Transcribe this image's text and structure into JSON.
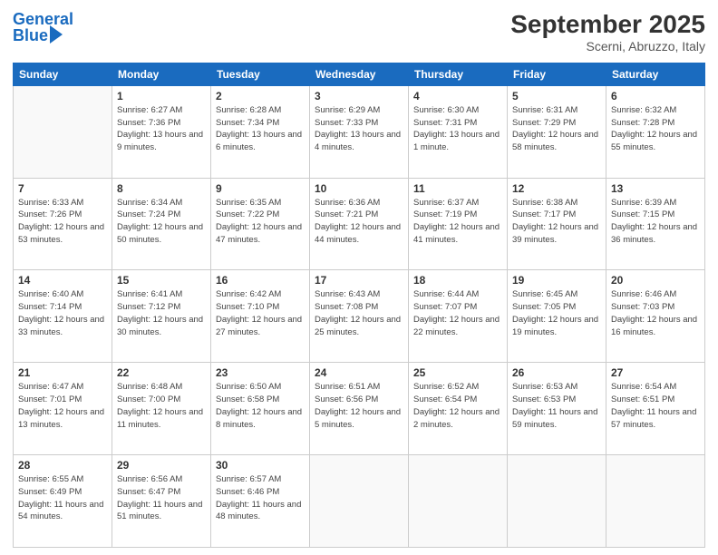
{
  "header": {
    "logo_line1": "General",
    "logo_line2": "Blue",
    "month_title": "September 2025",
    "subtitle": "Scerni, Abruzzo, Italy"
  },
  "days_of_week": [
    "Sunday",
    "Monday",
    "Tuesday",
    "Wednesday",
    "Thursday",
    "Friday",
    "Saturday"
  ],
  "weeks": [
    [
      {
        "day": "",
        "sunrise": "",
        "sunset": "",
        "daylight": "",
        "empty": true
      },
      {
        "day": "1",
        "sunrise": "Sunrise: 6:27 AM",
        "sunset": "Sunset: 7:36 PM",
        "daylight": "Daylight: 13 hours and 9 minutes."
      },
      {
        "day": "2",
        "sunrise": "Sunrise: 6:28 AM",
        "sunset": "Sunset: 7:34 PM",
        "daylight": "Daylight: 13 hours and 6 minutes."
      },
      {
        "day": "3",
        "sunrise": "Sunrise: 6:29 AM",
        "sunset": "Sunset: 7:33 PM",
        "daylight": "Daylight: 13 hours and 4 minutes."
      },
      {
        "day": "4",
        "sunrise": "Sunrise: 6:30 AM",
        "sunset": "Sunset: 7:31 PM",
        "daylight": "Daylight: 13 hours and 1 minute."
      },
      {
        "day": "5",
        "sunrise": "Sunrise: 6:31 AM",
        "sunset": "Sunset: 7:29 PM",
        "daylight": "Daylight: 12 hours and 58 minutes."
      },
      {
        "day": "6",
        "sunrise": "Sunrise: 6:32 AM",
        "sunset": "Sunset: 7:28 PM",
        "daylight": "Daylight: 12 hours and 55 minutes."
      }
    ],
    [
      {
        "day": "7",
        "sunrise": "Sunrise: 6:33 AM",
        "sunset": "Sunset: 7:26 PM",
        "daylight": "Daylight: 12 hours and 53 minutes."
      },
      {
        "day": "8",
        "sunrise": "Sunrise: 6:34 AM",
        "sunset": "Sunset: 7:24 PM",
        "daylight": "Daylight: 12 hours and 50 minutes."
      },
      {
        "day": "9",
        "sunrise": "Sunrise: 6:35 AM",
        "sunset": "Sunset: 7:22 PM",
        "daylight": "Daylight: 12 hours and 47 minutes."
      },
      {
        "day": "10",
        "sunrise": "Sunrise: 6:36 AM",
        "sunset": "Sunset: 7:21 PM",
        "daylight": "Daylight: 12 hours and 44 minutes."
      },
      {
        "day": "11",
        "sunrise": "Sunrise: 6:37 AM",
        "sunset": "Sunset: 7:19 PM",
        "daylight": "Daylight: 12 hours and 41 minutes."
      },
      {
        "day": "12",
        "sunrise": "Sunrise: 6:38 AM",
        "sunset": "Sunset: 7:17 PM",
        "daylight": "Daylight: 12 hours and 39 minutes."
      },
      {
        "day": "13",
        "sunrise": "Sunrise: 6:39 AM",
        "sunset": "Sunset: 7:15 PM",
        "daylight": "Daylight: 12 hours and 36 minutes."
      }
    ],
    [
      {
        "day": "14",
        "sunrise": "Sunrise: 6:40 AM",
        "sunset": "Sunset: 7:14 PM",
        "daylight": "Daylight: 12 hours and 33 minutes."
      },
      {
        "day": "15",
        "sunrise": "Sunrise: 6:41 AM",
        "sunset": "Sunset: 7:12 PM",
        "daylight": "Daylight: 12 hours and 30 minutes."
      },
      {
        "day": "16",
        "sunrise": "Sunrise: 6:42 AM",
        "sunset": "Sunset: 7:10 PM",
        "daylight": "Daylight: 12 hours and 27 minutes."
      },
      {
        "day": "17",
        "sunrise": "Sunrise: 6:43 AM",
        "sunset": "Sunset: 7:08 PM",
        "daylight": "Daylight: 12 hours and 25 minutes."
      },
      {
        "day": "18",
        "sunrise": "Sunrise: 6:44 AM",
        "sunset": "Sunset: 7:07 PM",
        "daylight": "Daylight: 12 hours and 22 minutes."
      },
      {
        "day": "19",
        "sunrise": "Sunrise: 6:45 AM",
        "sunset": "Sunset: 7:05 PM",
        "daylight": "Daylight: 12 hours and 19 minutes."
      },
      {
        "day": "20",
        "sunrise": "Sunrise: 6:46 AM",
        "sunset": "Sunset: 7:03 PM",
        "daylight": "Daylight: 12 hours and 16 minutes."
      }
    ],
    [
      {
        "day": "21",
        "sunrise": "Sunrise: 6:47 AM",
        "sunset": "Sunset: 7:01 PM",
        "daylight": "Daylight: 12 hours and 13 minutes."
      },
      {
        "day": "22",
        "sunrise": "Sunrise: 6:48 AM",
        "sunset": "Sunset: 7:00 PM",
        "daylight": "Daylight: 12 hours and 11 minutes."
      },
      {
        "day": "23",
        "sunrise": "Sunrise: 6:50 AM",
        "sunset": "Sunset: 6:58 PM",
        "daylight": "Daylight: 12 hours and 8 minutes."
      },
      {
        "day": "24",
        "sunrise": "Sunrise: 6:51 AM",
        "sunset": "Sunset: 6:56 PM",
        "daylight": "Daylight: 12 hours and 5 minutes."
      },
      {
        "day": "25",
        "sunrise": "Sunrise: 6:52 AM",
        "sunset": "Sunset: 6:54 PM",
        "daylight": "Daylight: 12 hours and 2 minutes."
      },
      {
        "day": "26",
        "sunrise": "Sunrise: 6:53 AM",
        "sunset": "Sunset: 6:53 PM",
        "daylight": "Daylight: 11 hours and 59 minutes."
      },
      {
        "day": "27",
        "sunrise": "Sunrise: 6:54 AM",
        "sunset": "Sunset: 6:51 PM",
        "daylight": "Daylight: 11 hours and 57 minutes."
      }
    ],
    [
      {
        "day": "28",
        "sunrise": "Sunrise: 6:55 AM",
        "sunset": "Sunset: 6:49 PM",
        "daylight": "Daylight: 11 hours and 54 minutes."
      },
      {
        "day": "29",
        "sunrise": "Sunrise: 6:56 AM",
        "sunset": "Sunset: 6:47 PM",
        "daylight": "Daylight: 11 hours and 51 minutes."
      },
      {
        "day": "30",
        "sunrise": "Sunrise: 6:57 AM",
        "sunset": "Sunset: 6:46 PM",
        "daylight": "Daylight: 11 hours and 48 minutes."
      },
      {
        "day": "",
        "sunrise": "",
        "sunset": "",
        "daylight": "",
        "empty": true
      },
      {
        "day": "",
        "sunrise": "",
        "sunset": "",
        "daylight": "",
        "empty": true
      },
      {
        "day": "",
        "sunrise": "",
        "sunset": "",
        "daylight": "",
        "empty": true
      },
      {
        "day": "",
        "sunrise": "",
        "sunset": "",
        "daylight": "",
        "empty": true
      }
    ]
  ]
}
